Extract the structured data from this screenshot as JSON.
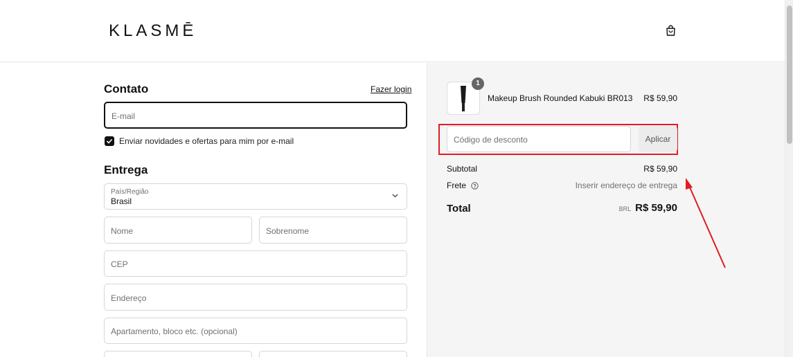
{
  "header": {
    "logo": "KLASMĒ",
    "bag_icon": "shopping-bag-icon"
  },
  "contact": {
    "title": "Contato",
    "login_link": "Fazer login",
    "email_placeholder": "E-mail",
    "newsletter_label": "Enviar novidades e ofertas para mim por e-mail",
    "newsletter_checked": true
  },
  "delivery": {
    "title": "Entrega",
    "country_label": "País/Região",
    "country_value": "Brasil",
    "first_name_placeholder": "Nome",
    "last_name_placeholder": "Sobrenome",
    "cep_placeholder": "CEP",
    "address_placeholder": "Endereço",
    "apartment_placeholder": "Apartamento, bloco etc. (opcional)"
  },
  "summary": {
    "product": {
      "name": "Makeup Brush Rounded Kabuki BR013",
      "price": "R$ 59,90",
      "quantity": "1"
    },
    "discount_placeholder": "Código de desconto",
    "apply_label": "Aplicar",
    "subtotal_label": "Subtotal",
    "subtotal_value": "R$ 59,90",
    "shipping_label": "Frete",
    "shipping_value": "Inserir endereço de entrega",
    "total_label": "Total",
    "total_currency": "BRL",
    "total_value": "R$ 59,90"
  },
  "colors": {
    "annotation_red": "#e01b24",
    "summary_bg": "#f5f5f5"
  }
}
